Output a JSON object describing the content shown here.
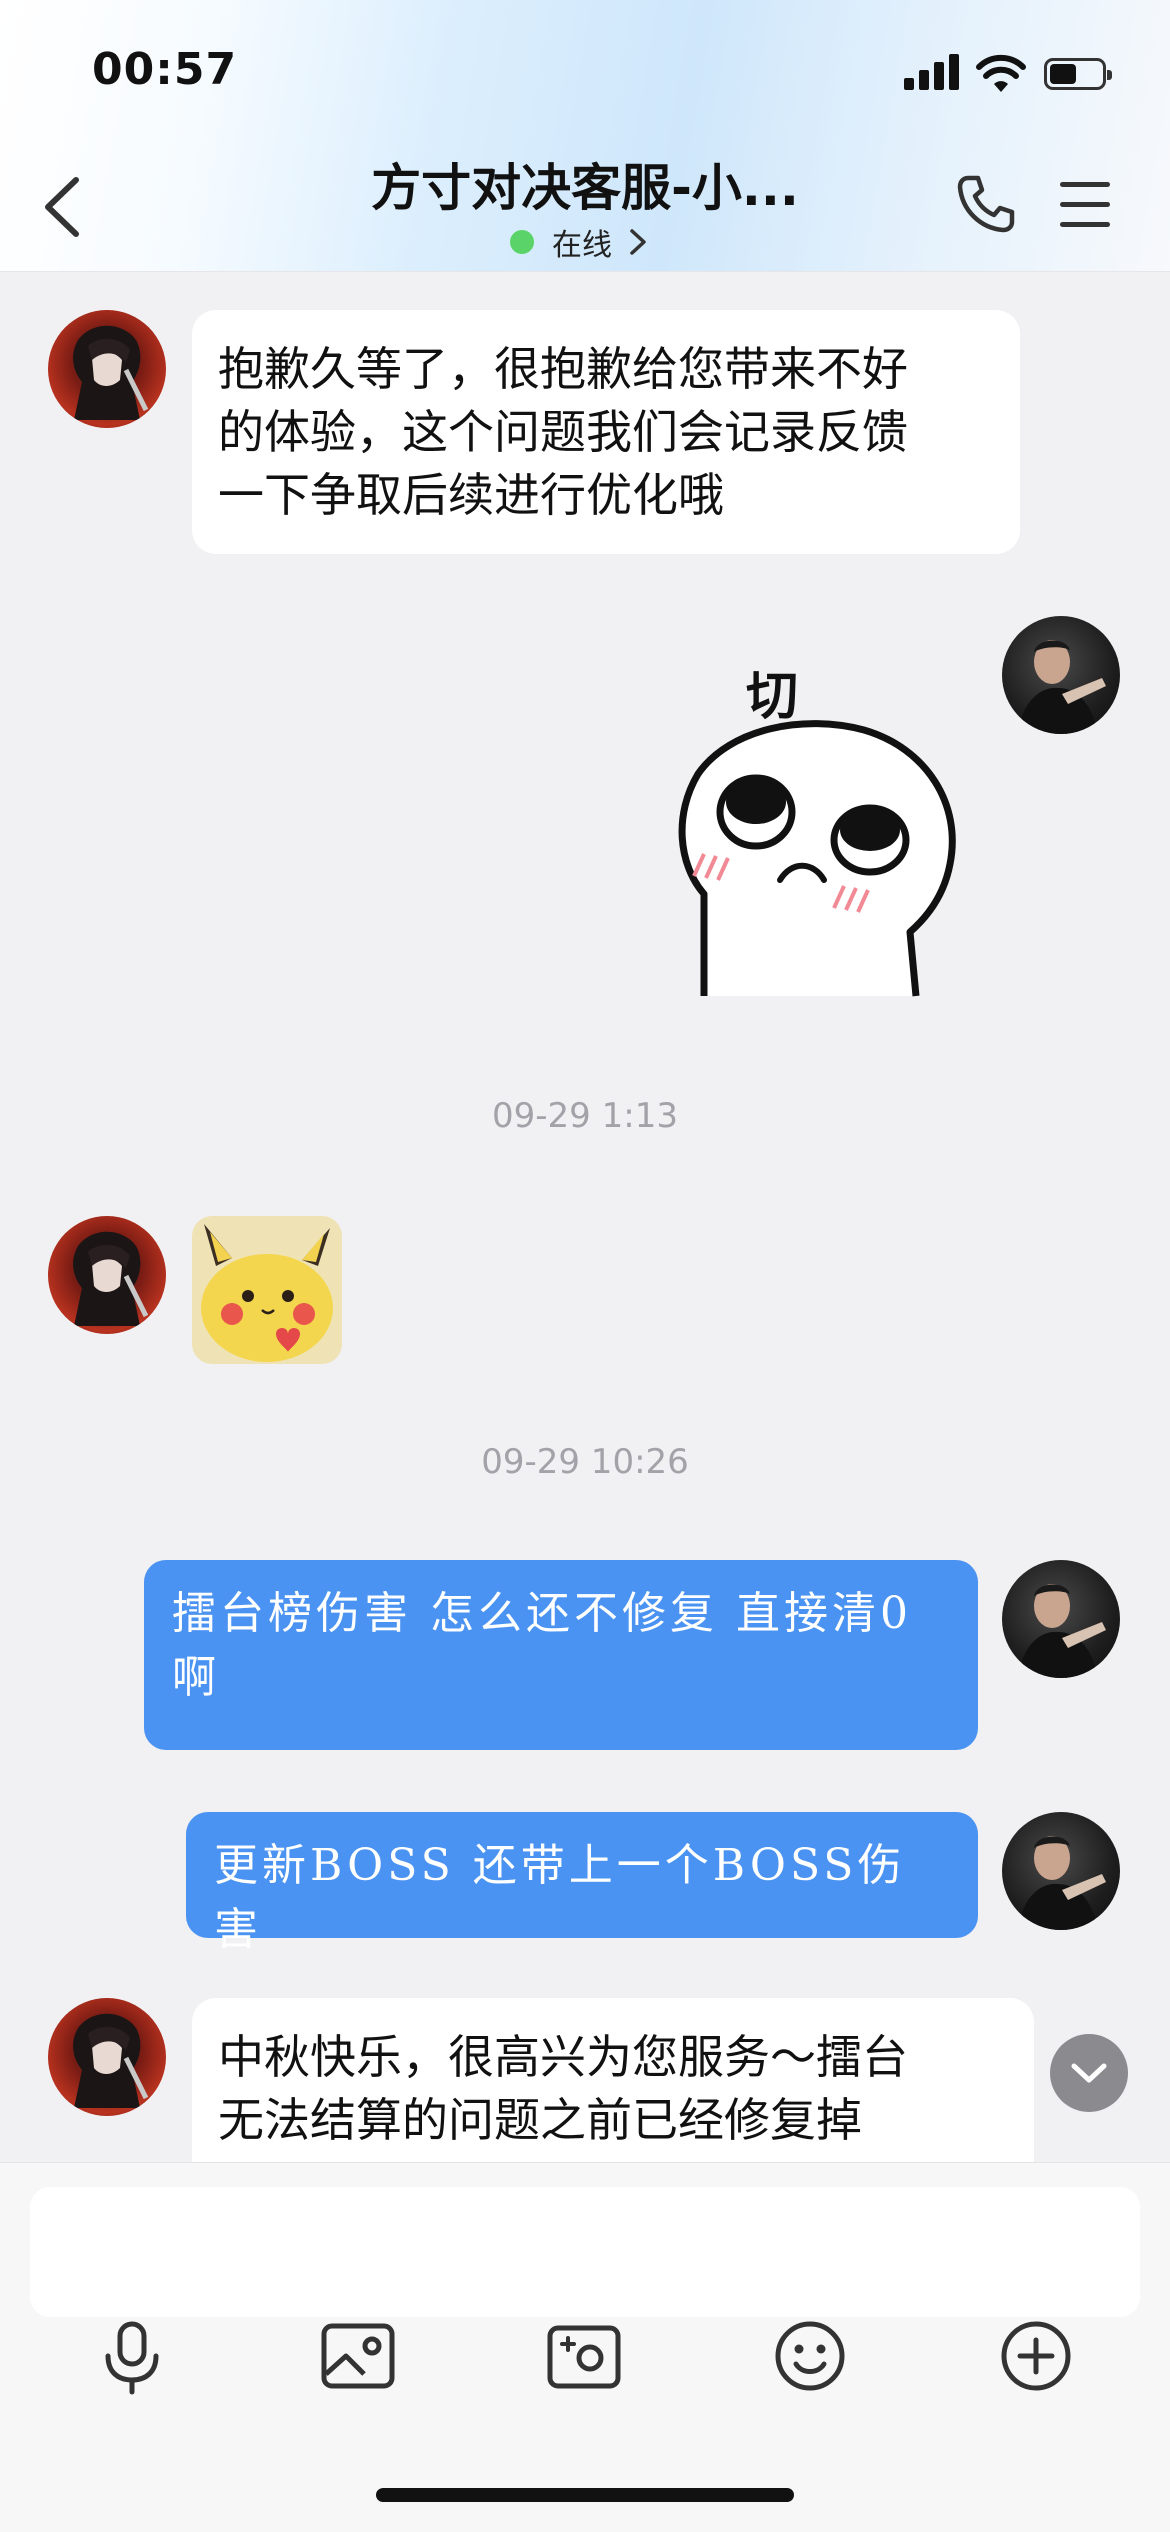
{
  "status_bar": {
    "time": "00:57"
  },
  "header": {
    "title": "方寸对决客服-小...",
    "status_text": "在线"
  },
  "messages": [
    {
      "lines": [
        "抱歉久等了，很抱歉给您带来不好",
        "的体验，这个问题我们会记录反馈",
        "一下争取后续进行优化哦"
      ]
    },
    {
      "sticker_caption": "切"
    },
    {
      "timestamp": "09-29 1:13"
    },
    {
      "timestamp": "09-29 10:26"
    },
    {
      "lines": [
        "擂台榜伤害  怎么还不修复  直接清0",
        "啊"
      ]
    },
    {
      "text": "更新BOSS  还带上一个BOSS伤害"
    },
    {
      "lines": [
        "中秋快乐，很高兴为您服务～擂台",
        "无法结算的问题之前已经修复掉"
      ]
    }
  ],
  "input": {
    "placeholder": ""
  },
  "colors": {
    "online": "#5ad469",
    "outgoing_bubble": "#4a93f2",
    "incoming_bubble": "#ffffff",
    "background": "#f1f1f3"
  },
  "icons": {
    "header": [
      "back-icon",
      "phone-icon",
      "menu-icon",
      "chevron-right-icon"
    ],
    "toolbar": [
      "microphone-icon",
      "image-icon",
      "camera-icon",
      "emoji-icon",
      "plus-icon"
    ]
  }
}
